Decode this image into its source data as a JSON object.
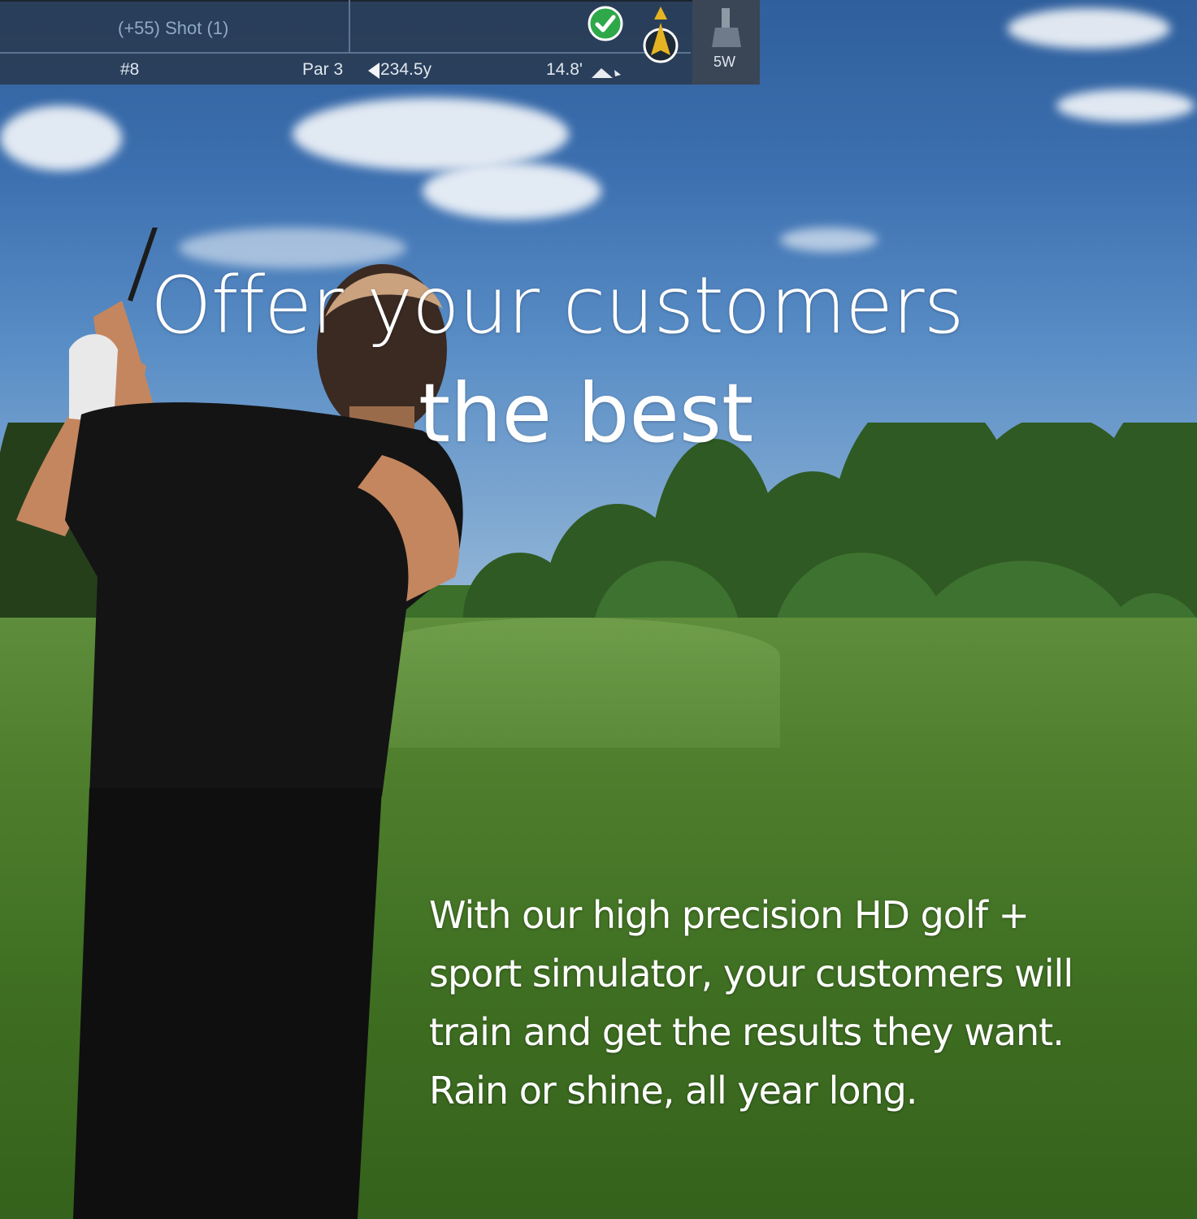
{
  "hud": {
    "shot": "(+55) Shot (1)",
    "hole": "#8",
    "par": "Par 3",
    "distance": "234.5y",
    "elevation": "14.8'",
    "club": "5W",
    "icons": [
      "check-icon",
      "ball-marker-icon",
      "flag-icon",
      "slope-icon",
      "club-icon"
    ],
    "colors": {
      "panel": "#28374b",
      "check": "#2fa84a",
      "marker": "#e6b422"
    }
  },
  "headline": {
    "line1": "Offer your customers",
    "line2": "the best"
  },
  "body": {
    "lines": [
      "With our high precision HD golf +",
      "sport simulator, your customers will",
      "train and get the results they want.",
      "Rain or shine, all year long."
    ]
  }
}
